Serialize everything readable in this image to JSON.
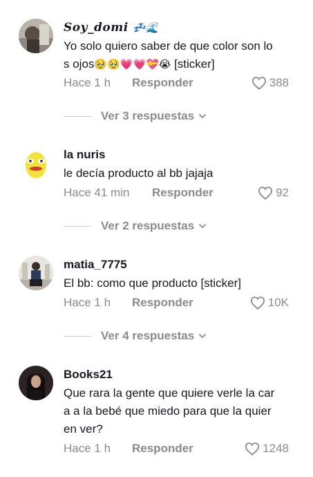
{
  "comments": [
    {
      "username": "Soy_domi",
      "username_emojis": "💤🌊",
      "text_line1": "Yo solo quiero saber de que color son lo",
      "text_line2": "s ojos",
      "text_emojis": "🥹🥹💗💗💝😭",
      "text_tail": "[sticker]",
      "time": "Hace 1 h",
      "reply_label": "Responder",
      "likes": "388",
      "view_replies": "Ver 3 respuestas"
    },
    {
      "username": "la nuris",
      "text": "le decía producto al bb jajaja",
      "time": "Hace 41 min",
      "reply_label": "Responder",
      "likes": "92",
      "view_replies": "Ver 2 respuestas"
    },
    {
      "username": "matia_7775",
      "text": "El bb: como que producto [sticker]",
      "time": "Hace 1 h",
      "reply_label": "Responder",
      "likes": "10K",
      "view_replies": "Ver 4 respuestas"
    },
    {
      "username": "Books21",
      "text_line1": "Que rara la gente que quiere verle la car",
      "text_line2": "a a la bebé que miedo para que la quier",
      "text_line3": "en ver?",
      "time": "Hace 1 h",
      "reply_label": "Responder",
      "likes": "1248"
    }
  ],
  "icons": {
    "like": "heart-outline-icon",
    "expand": "chevron-down-icon"
  },
  "colors": {
    "text": "#161823",
    "muted": "#8a8b91",
    "divider": "#c9c9cd"
  }
}
